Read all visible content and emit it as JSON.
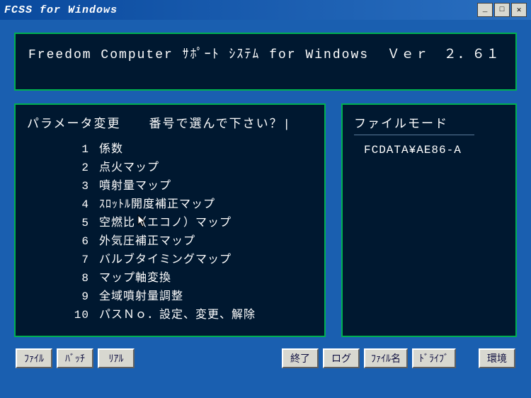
{
  "window": {
    "title": "FCSS for Windows"
  },
  "header": {
    "line1": "Freedom Computer ｻﾎﾟｰﾄ ｼｽﾃﾑ for Windows  Ｖｅｒ　２．６１"
  },
  "leftPanel": {
    "title": "パラメータ変更",
    "prompt": "番号で選んで下さい？|"
  },
  "menu": [
    {
      "num": "1",
      "label": "係数"
    },
    {
      "num": "2",
      "label": "点火マップ"
    },
    {
      "num": "3",
      "label": "噴射量マップ"
    },
    {
      "num": "4",
      "label": "ｽﾛｯﾄﾙ開度補正マップ"
    },
    {
      "num": "5",
      "label": "空燃比（エコノ）マップ"
    },
    {
      "num": "6",
      "label": "外気圧補正マップ"
    },
    {
      "num": "7",
      "label": "バルブタイミングマップ"
    },
    {
      "num": "8",
      "label": "マップ軸変換"
    },
    {
      "num": "9",
      "label": "全域噴射量調整"
    },
    {
      "num": "10",
      "label": "パスＮｏ．設定、変更、解除"
    }
  ],
  "rightPanel": {
    "title": "ファイルモード",
    "path": "FCDATA¥AE86-A"
  },
  "buttons": {
    "b0": "ﾌｧｲﾙ",
    "b1": "ﾊﾞｯﾁ",
    "b2": "ﾘｱﾙ",
    "b3": "終了",
    "b4": "ログ",
    "b5": "ﾌｧｲﾙ名",
    "b6": "ﾄﾞﾗｲﾌﾞ",
    "b7": "環境"
  }
}
